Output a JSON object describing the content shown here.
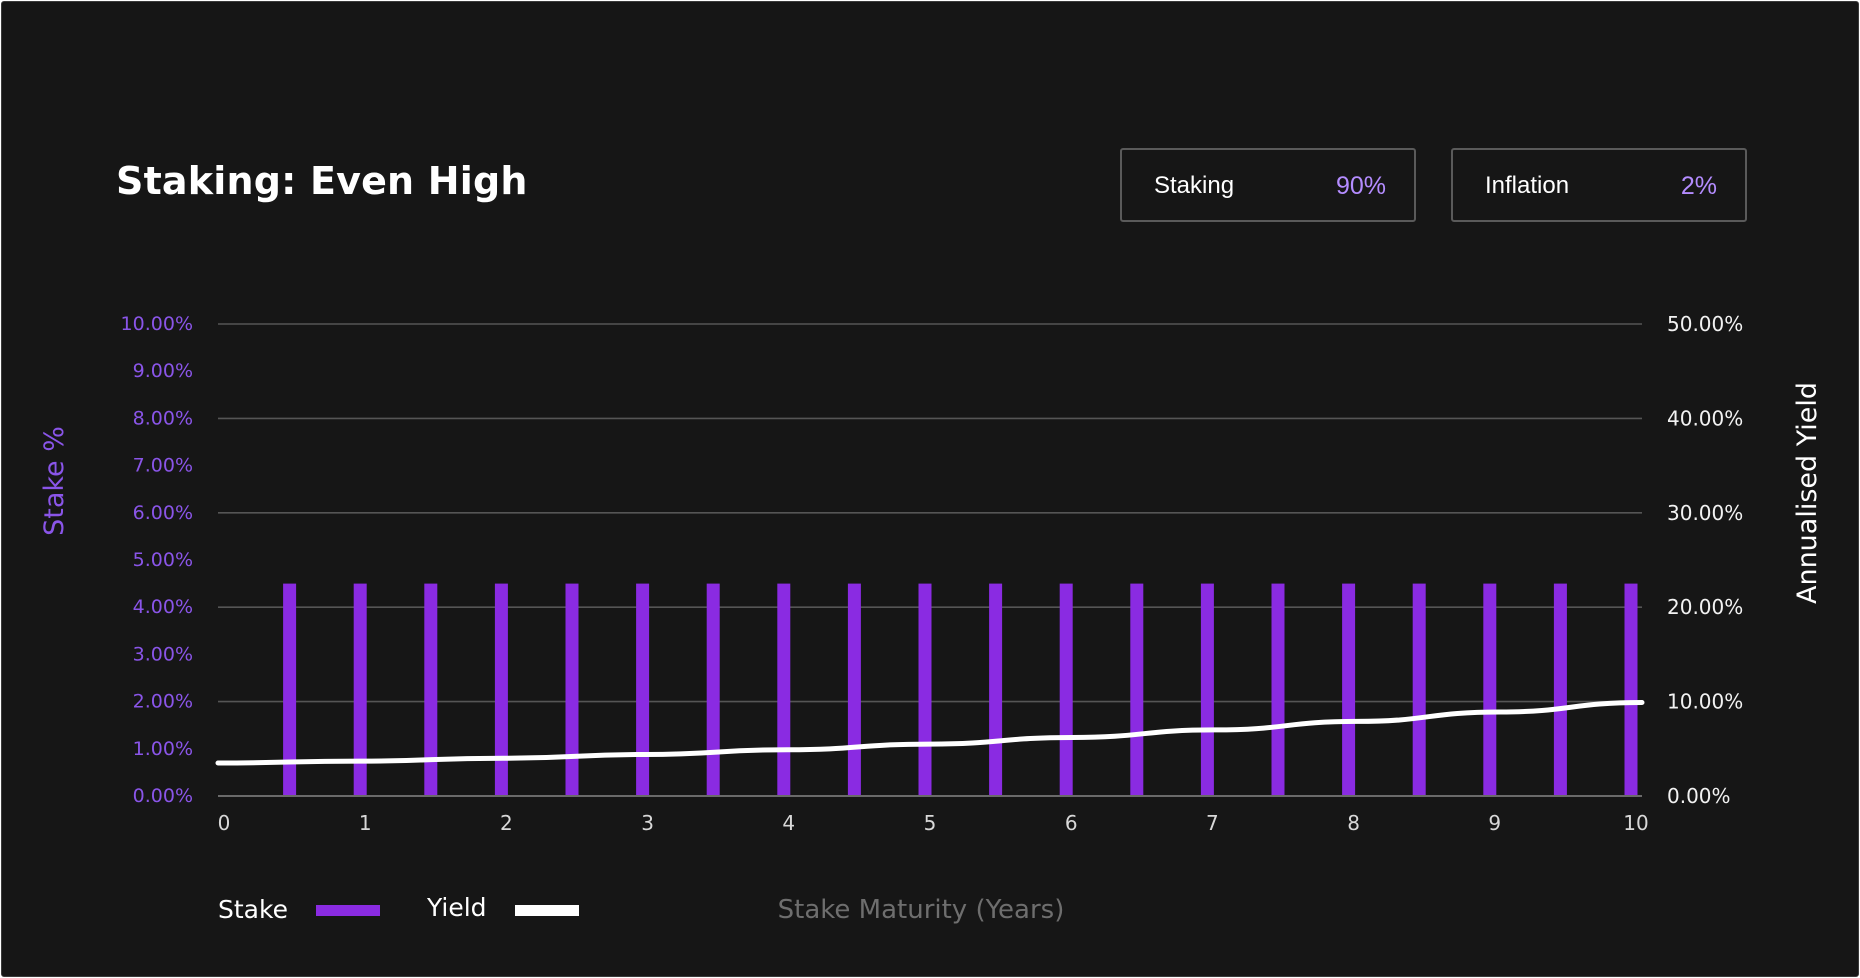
{
  "header": {
    "title": "Staking: Even High",
    "staking_label": "Staking",
    "staking_value": "90%",
    "inflation_label": "Inflation",
    "inflation_value": "2%"
  },
  "colors": {
    "background": "#161616",
    "stake": "#8a2be2",
    "yield": "#ffffff",
    "accent_text": "#b48cff",
    "gridline": "#555555"
  },
  "chart_data": {
    "type": "bar",
    "xlabel": "Stake Maturity (Years)",
    "ylabel_left": "Stake %",
    "ylabel_right": "Annualised Yield",
    "x_ticks": [
      "0",
      "1",
      "2",
      "3",
      "4",
      "5",
      "6",
      "7",
      "8",
      "9",
      "10"
    ],
    "x_range": [
      0,
      10
    ],
    "y_left_ticks": [
      "0.00%",
      "1.00%",
      "2.00%",
      "3.00%",
      "4.00%",
      "5.00%",
      "6.00%",
      "7.00%",
      "8.00%",
      "9.00%",
      "10.00%"
    ],
    "y_left_range": [
      0,
      10
    ],
    "y_right_ticks": [
      "0.00%",
      "10.00%",
      "20.00%",
      "30.00%",
      "40.00%",
      "50.00%"
    ],
    "y_right_range": [
      0,
      50
    ],
    "grid": true,
    "legend": [
      {
        "label": "Stake",
        "kind": "bar"
      },
      {
        "label": "Yield",
        "kind": "line"
      }
    ],
    "legend_position": "bottom-left",
    "series": [
      {
        "name": "Stake",
        "axis": "left",
        "type": "bar",
        "x": [
          0.5,
          1.0,
          1.5,
          2.0,
          2.5,
          3.0,
          3.5,
          4.0,
          4.5,
          5.0,
          5.5,
          6.0,
          6.5,
          7.0,
          7.5,
          8.0,
          8.5,
          9.0,
          9.5,
          10.0
        ],
        "values": [
          4.5,
          4.5,
          4.5,
          4.5,
          4.5,
          4.5,
          4.5,
          4.5,
          4.5,
          4.5,
          4.5,
          4.5,
          4.5,
          4.5,
          4.5,
          4.5,
          4.5,
          4.5,
          4.5,
          4.5
        ]
      },
      {
        "name": "Yield",
        "axis": "right",
        "type": "line",
        "x": [
          0,
          1,
          2,
          3,
          4,
          5,
          6,
          7,
          8,
          9,
          10
        ],
        "values": [
          3.5,
          3.7,
          4.0,
          4.4,
          4.9,
          5.5,
          6.2,
          7.0,
          7.9,
          8.9,
          9.9
        ]
      }
    ]
  }
}
